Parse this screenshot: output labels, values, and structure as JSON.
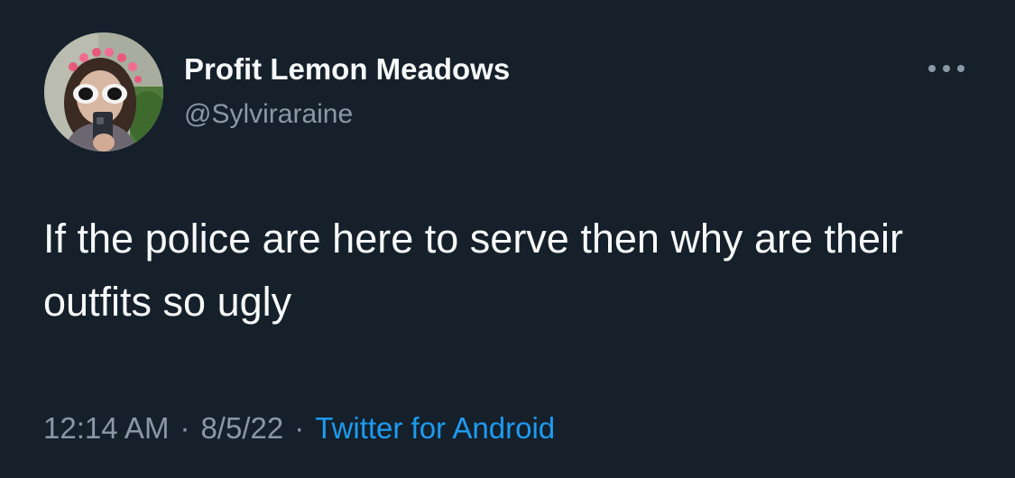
{
  "tweet": {
    "author": {
      "display_name": "Profit Lemon Meadows",
      "handle": "@Sylviraraine"
    },
    "text": "If the police are here to serve then why are their outfits so ugly",
    "time": "12:14 AM",
    "separator": "·",
    "date": "8/5/22",
    "source": "Twitter for Android"
  },
  "colors": {
    "background": "#15202b",
    "primary_text": "#f7f9f9",
    "secondary_text": "#8b98a5",
    "link": "#1d9bf0"
  },
  "icons": {
    "more": "more-horizontal-icon",
    "avatar": "profile-photo"
  }
}
